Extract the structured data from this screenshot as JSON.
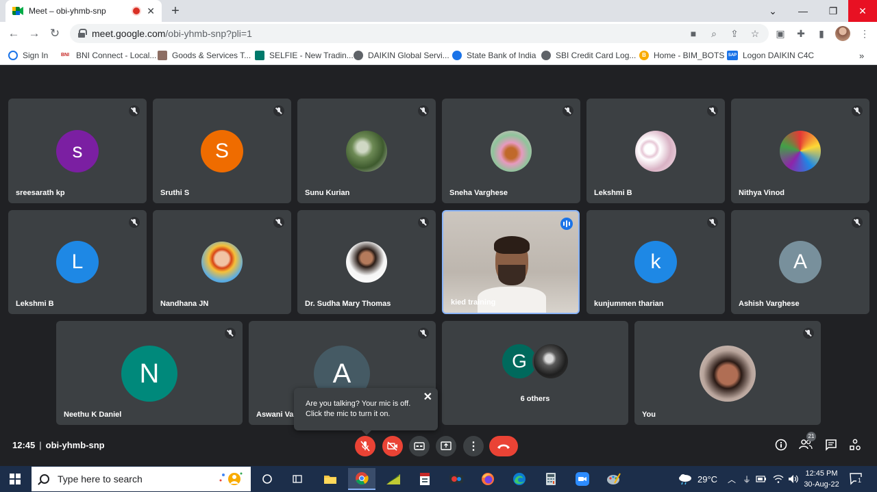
{
  "browser": {
    "tab_title": "Meet – obi-yhmb-snp",
    "url_host": "meet.google.com",
    "url_path": "/obi-yhmb-snp?pli=1"
  },
  "bookmarks": [
    {
      "label": "Sign In",
      "color": "#1a73e8"
    },
    {
      "label": "BNI Connect - Local...",
      "color": "#c5221f",
      "icon_text": "BNI"
    },
    {
      "label": "Goods & Services T...",
      "color": "#8d6e63"
    },
    {
      "label": "SELFIE - New Tradin...",
      "color": "#00796b"
    },
    {
      "label": "DAIKIN Global Servi...",
      "color": "#5f6368"
    },
    {
      "label": "State Bank of India",
      "color": "#1a73e8"
    },
    {
      "label": "SBI Credit Card Log...",
      "color": "#5f6368"
    },
    {
      "label": "Home - BIM_BOTS",
      "color": "#f9ab00",
      "icon_text": "B"
    },
    {
      "label": "Logon DAIKIN C4C",
      "color": "#1a73e8",
      "icon_text": "SAP"
    }
  ],
  "participants": [
    {
      "name": "sreesarath kp",
      "initial": "s",
      "color": "#7b1fa2"
    },
    {
      "name": "Sruthi S",
      "initial": "S",
      "color": "#ef6c00"
    },
    {
      "name": "Sunu Kurian",
      "icon": "photo-trees"
    },
    {
      "name": "Sneha Varghese",
      "icon": "photo-flowers"
    },
    {
      "name": "Lekshmi B",
      "icon": "photo-marshmallows"
    },
    {
      "name": "Nithya Vinod",
      "icon": "photo-cartoon"
    },
    {
      "name": "Lekshmi B",
      "initial": "L",
      "color": "#1e88e5"
    },
    {
      "name": "Nandhana JN",
      "icon": "photo-portrait"
    },
    {
      "name": "Dr. Sudha Mary Thomas",
      "icon": "photo-portrait"
    },
    {
      "name": "kied training",
      "icon": "video-feed"
    },
    {
      "name": "kunjummen tharian",
      "initial": "k",
      "color": "#1e88e5"
    },
    {
      "name": "Ashish Varghese",
      "initial": "A",
      "color": "#78909c"
    },
    {
      "name": "Neethu K Daniel",
      "initial": "N",
      "color": "#00897b"
    },
    {
      "name": "Aswani Vas",
      "initial": "A",
      "color": "#455a64"
    },
    {
      "name": "6 others",
      "initial": "G",
      "color": "#00695c"
    },
    {
      "name": "You",
      "icon": "photo-portrait"
    }
  ],
  "tooltip": {
    "line1": "Are you talking? Your mic is off.",
    "line2": "Click the mic to turn it on."
  },
  "meeting": {
    "time": "12:45",
    "separator": "|",
    "code": "obi-yhmb-snp",
    "people_count": "21"
  },
  "taskbar": {
    "search_placeholder": "Type here to search",
    "temperature": "29°C",
    "time": "12:45 PM",
    "date": "30-Aug-22",
    "notification_count": "1"
  }
}
